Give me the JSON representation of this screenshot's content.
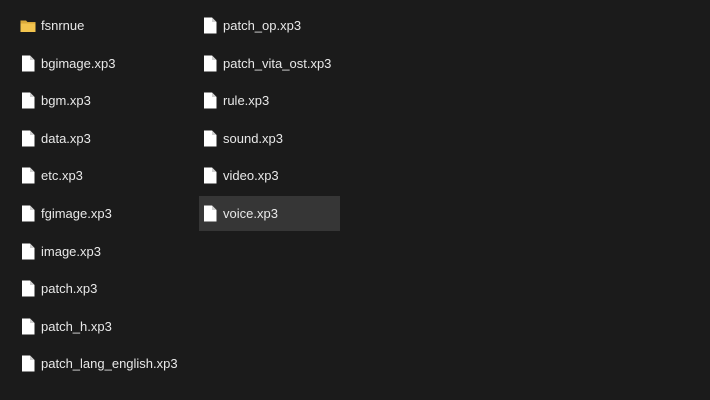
{
  "file_list": {
    "columns": [
      {
        "items": [
          {
            "name": "fsnrnue",
            "icon": "folder-icon",
            "selected": false
          },
          {
            "name": "bgimage.xp3",
            "icon": "file-icon",
            "selected": false
          },
          {
            "name": "bgm.xp3",
            "icon": "file-icon",
            "selected": false
          },
          {
            "name": "data.xp3",
            "icon": "file-icon",
            "selected": false
          },
          {
            "name": "etc.xp3",
            "icon": "file-icon",
            "selected": false
          },
          {
            "name": "fgimage.xp3",
            "icon": "file-icon",
            "selected": false
          },
          {
            "name": "image.xp3",
            "icon": "file-icon",
            "selected": false
          },
          {
            "name": "patch.xp3",
            "icon": "file-icon",
            "selected": false
          },
          {
            "name": "patch_h.xp3",
            "icon": "file-icon",
            "selected": false
          },
          {
            "name": "patch_lang_english.xp3",
            "icon": "file-icon",
            "selected": false
          }
        ]
      },
      {
        "items": [
          {
            "name": "patch_op.xp3",
            "icon": "file-icon",
            "selected": false
          },
          {
            "name": "patch_vita_ost.xp3",
            "icon": "file-icon",
            "selected": false
          },
          {
            "name": "rule.xp3",
            "icon": "file-icon",
            "selected": false
          },
          {
            "name": "sound.xp3",
            "icon": "file-icon",
            "selected": false
          },
          {
            "name": "video.xp3",
            "icon": "file-icon",
            "selected": false
          },
          {
            "name": "voice.xp3",
            "icon": "file-icon",
            "selected": true
          }
        ]
      }
    ]
  },
  "colors": {
    "background": "#1b1b1b",
    "text": "#e8e8e8",
    "selection": "#363636",
    "folder": "#f3c44e",
    "file": "#ffffff"
  }
}
